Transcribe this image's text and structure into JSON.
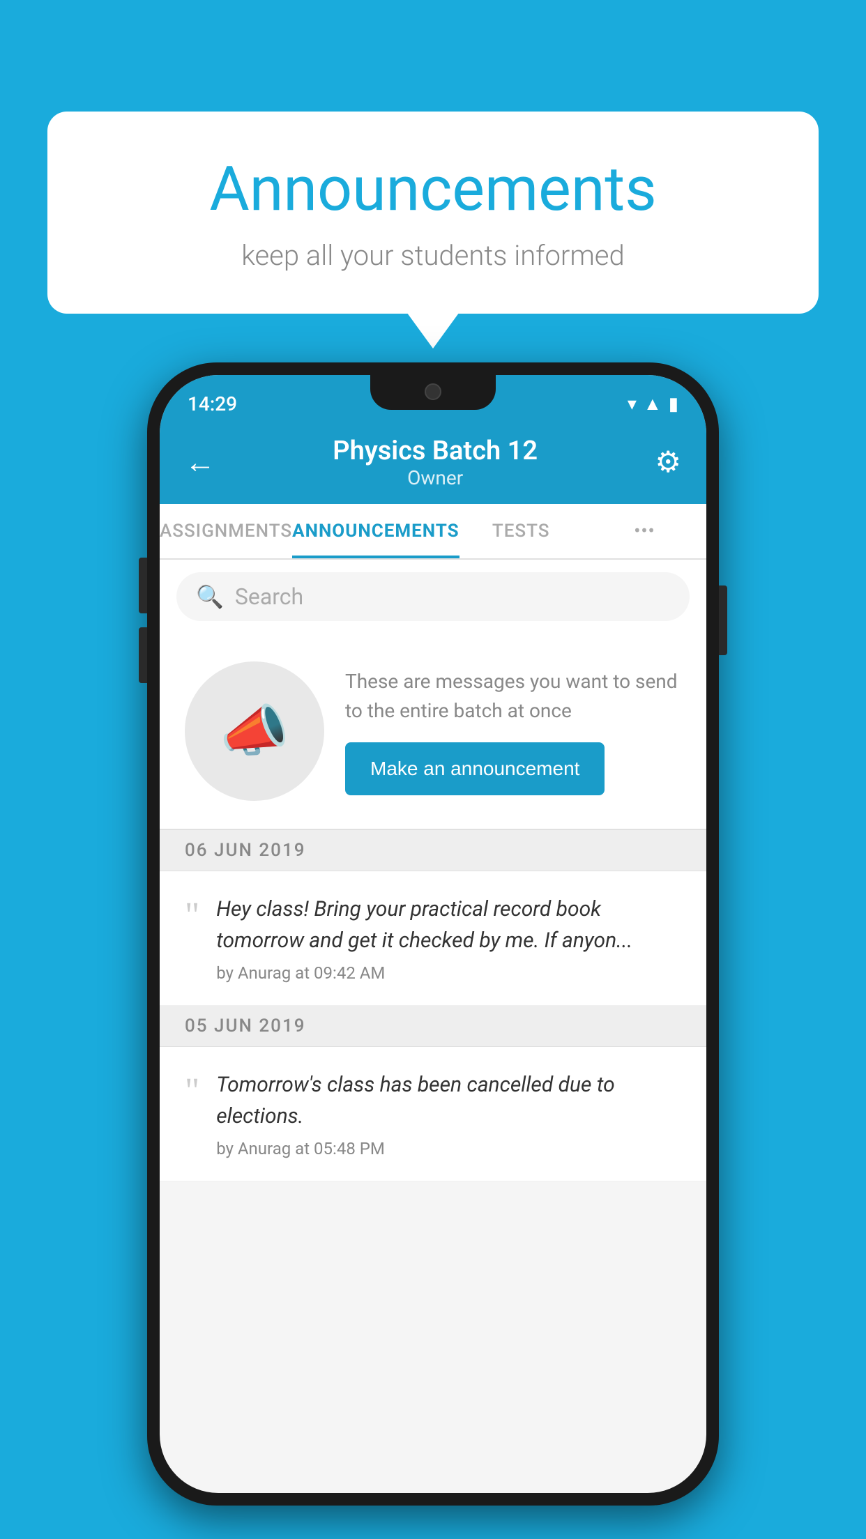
{
  "page": {
    "background_color": "#1AABDC"
  },
  "speech_bubble": {
    "title": "Announcements",
    "subtitle": "keep all your students informed"
  },
  "phone": {
    "status_bar": {
      "time": "14:29"
    },
    "header": {
      "title": "Physics Batch 12",
      "subtitle": "Owner",
      "back_label": "←",
      "gear_label": "⚙"
    },
    "tabs": [
      {
        "label": "ASSIGNMENTS",
        "active": false
      },
      {
        "label": "ANNOUNCEMENTS",
        "active": true
      },
      {
        "label": "TESTS",
        "active": false
      },
      {
        "label": "•••",
        "active": false
      }
    ],
    "search": {
      "placeholder": "Search"
    },
    "empty_state": {
      "description": "These are messages you want to send to the entire batch at once",
      "button_label": "Make an announcement"
    },
    "announcements": [
      {
        "date": "06  JUN  2019",
        "text": "Hey class! Bring your practical record book tomorrow and get it checked by me. If anyon...",
        "meta": "by Anurag at 09:42 AM"
      },
      {
        "date": "05  JUN  2019",
        "text": "Tomorrow's class has been cancelled due to elections.",
        "meta": "by Anurag at 05:48 PM"
      }
    ]
  }
}
